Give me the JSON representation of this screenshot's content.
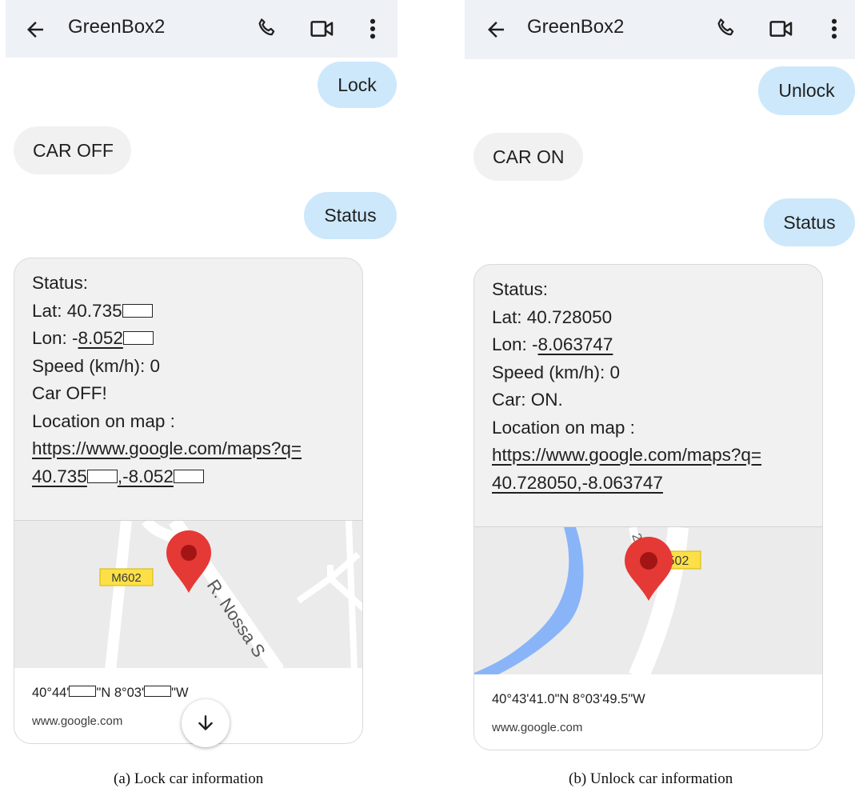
{
  "panel_a": {
    "header": {
      "title": "GreenBox2",
      "icons": [
        "back-arrow-icon",
        "phone-icon",
        "video-camera-icon",
        "more-vert-icon"
      ]
    },
    "messages": {
      "lock": "Lock",
      "car_off": "CAR OFF",
      "status": "Status"
    },
    "status_reply": {
      "line1": "Status:",
      "lat_label": "Lat: ",
      "lat_value": "40.735",
      "lon_label": "Lon: -",
      "lon_value": "8.052",
      "speed": "Speed (km/h): 0",
      "car_state": "Car OFF!",
      "location_label": "Location on map :",
      "link_line1": "https://www.google.com/maps?q=",
      "link_lat": "40.735",
      "link_sep": ",-8.052"
    },
    "map": {
      "road_label": "M602",
      "street_label": "R. Nossa S"
    },
    "preview": {
      "coord_part1": "40°44'",
      "coord_part2": "\"N 8°03'",
      "coord_part3": "\"W",
      "domain": "www.google.com"
    },
    "scroll_icon": "arrow-down-icon",
    "caption": "(a) Lock car information"
  },
  "panel_b": {
    "header": {
      "title": "GreenBox2",
      "icons": [
        "back-arrow-icon",
        "phone-icon",
        "video-camera-icon",
        "more-vert-icon"
      ]
    },
    "messages": {
      "unlock": "Unlock",
      "car_on": "CAR ON",
      "status": "Status"
    },
    "status_reply": {
      "line1": "Status:",
      "lat": "Lat: 40.728050",
      "lon_label": "Lon: -",
      "lon_value": "8.063747",
      "speed": "Speed (km/h): 0",
      "car_state": "Car: ON.",
      "location_label": "Location on map :",
      "link_line1": "https://www.google.com/maps?q=",
      "link_line2": "40.728050,-8.063747"
    },
    "map": {
      "road_label": "502",
      "road_label_partial": "2"
    },
    "preview": {
      "coords": "40°43'41.0\"N 8°03'49.5\"W",
      "domain": "www.google.com"
    },
    "caption": "(b) Unlock car information"
  },
  "colors": {
    "appbar": "#eef2f7",
    "outgoing_bubble": "#cde8fb",
    "incoming_bubble": "#f1f1f1",
    "map_pin": "#e53935",
    "road_label_bg": "#fde047",
    "river": "#8ab4f8"
  }
}
